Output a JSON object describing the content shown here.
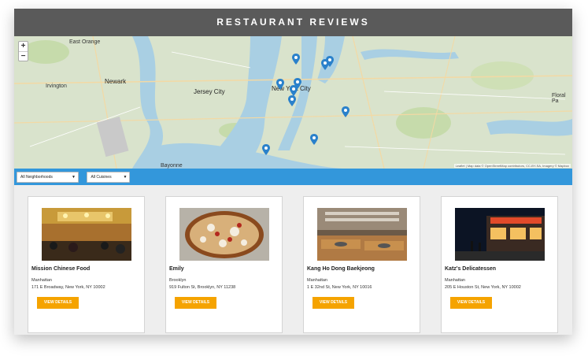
{
  "header": {
    "title": "RESTAURANT REVIEWS"
  },
  "map": {
    "zoom_in": "+",
    "zoom_out": "−",
    "labels": [
      "East Orange",
      "Irvington",
      "Newark",
      "Jersey City",
      "New York City",
      "Bayonne",
      "Floral Pa"
    ],
    "attribution": "Leaflet | Map data © OpenStreetMap contributors, CC-BY-SA, Imagery © Mapbox"
  },
  "filters": {
    "neighborhoods": {
      "selected": "All Neighborhoods"
    },
    "cuisines": {
      "selected": "All Cuisines"
    }
  },
  "restaurants": [
    {
      "name": "Mission Chinese Food",
      "neighborhood": "Manhattan",
      "address": "171 E Broadway, New York, NY 10002",
      "button": "VIEW DETAILS"
    },
    {
      "name": "Emily",
      "neighborhood": "Brooklyn",
      "address": "919 Fulton St, Brooklyn, NY 11238",
      "button": "VIEW DETAILS"
    },
    {
      "name": "Kang Ho Dong Baekjeong",
      "neighborhood": "Manhattan",
      "address": "1 E 32nd St, New York, NY 10016",
      "button": "VIEW DETAILS"
    },
    {
      "name": "Katz's Delicatessen",
      "neighborhood": "Manhattan",
      "address": "205 E Houston St, New York, NY 10002",
      "button": "VIEW DETAILS"
    }
  ],
  "colors": {
    "header": "#5a5a5a",
    "filterbar": "#3397db",
    "button": "#f5a300",
    "water": "#a9cfe3",
    "land": "#d9e3cc"
  }
}
